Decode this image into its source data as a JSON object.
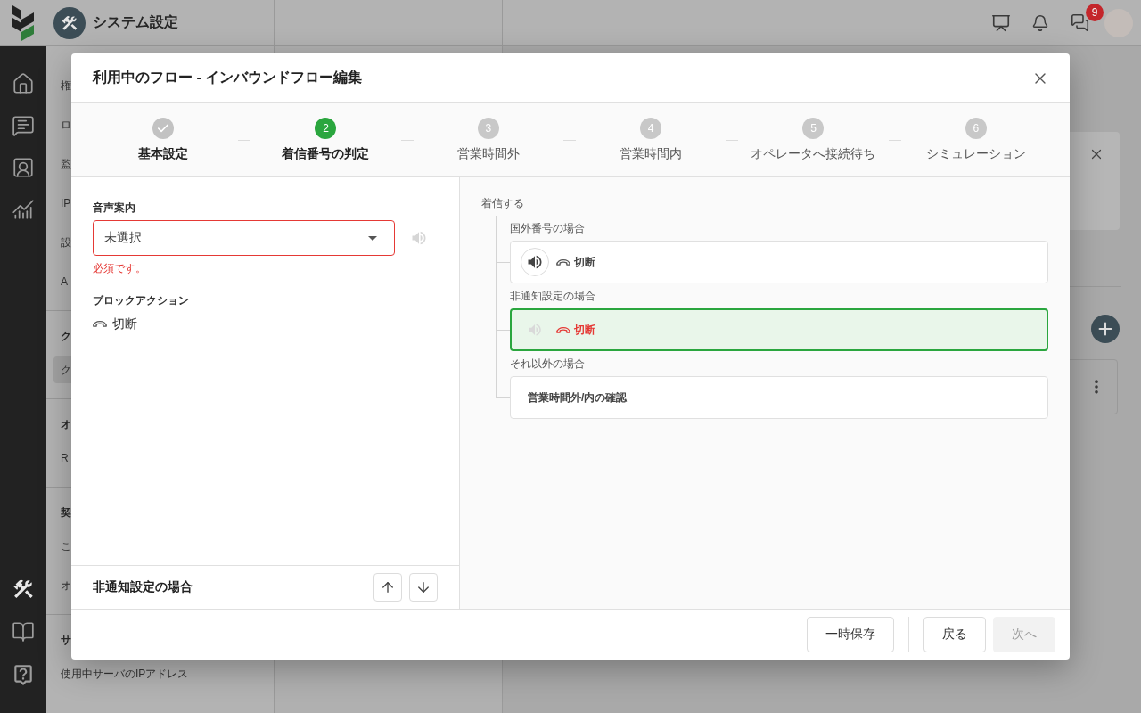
{
  "rail": {
    "top": [
      {
        "selected": false
      },
      {
        "selected": false
      },
      {
        "selected": false
      },
      {
        "selected": false
      }
    ],
    "bottom": [
      {
        "selected": true
      },
      {
        "selected": false
      },
      {
        "selected": false
      }
    ]
  },
  "header": {
    "title": "システム設定",
    "chat_badge": "9"
  },
  "sidebar": {
    "sections": [
      {
        "items": [
          {
            "label": "権",
            "selected": false
          },
          {
            "label": "ロ",
            "selected": false
          },
          {
            "label": "監",
            "selected": false
          },
          {
            "label": "IP",
            "selected": false
          },
          {
            "label": "設",
            "selected": false
          },
          {
            "label": "A",
            "selected": false
          }
        ]
      },
      {
        "title": "ク",
        "items": [
          {
            "label": "ク",
            "selected": true
          }
        ]
      },
      {
        "title": "オ",
        "items": [
          {
            "label": "R",
            "selected": false
          }
        ]
      },
      {
        "title": "契",
        "items": [
          {
            "label": "こ",
            "selected": false
          },
          {
            "label": "オ",
            "selected": false
          }
        ]
      },
      {
        "title": "サ",
        "items": [
          {
            "label": "使用中サーバのIPアドレス",
            "selected": false
          }
        ]
      }
    ]
  },
  "modal": {
    "title": "利用中のフロー - インバウンドフロー編集",
    "steps": [
      {
        "label": "基本設定",
        "completed": true,
        "selected": false
      },
      {
        "number": "2",
        "label": "着信番号の判定",
        "completed": false,
        "selected": true
      },
      {
        "number": "3",
        "label": "営業時間外",
        "completed": false,
        "selected": false
      },
      {
        "number": "4",
        "label": "営業時間内",
        "completed": false,
        "selected": false
      },
      {
        "number": "5",
        "label": "オペレータへ接続待ち",
        "completed": false,
        "selected": false
      },
      {
        "number": "6",
        "label": "シミュレーション",
        "completed": false,
        "selected": false
      }
    ],
    "form": {
      "voice_guide": {
        "label": "音声案内",
        "value": "未選択",
        "invalid": true,
        "error": "必須です。",
        "preview_disabled": true
      },
      "block_action": {
        "label": "ブロックアクション",
        "value": "切断"
      }
    },
    "selection_bar": {
      "label": "非通知設定の場合"
    },
    "flow": {
      "root": "着信する",
      "branches": [
        {
          "label": "国外番号の場合",
          "kind": "action",
          "selected": false,
          "audio_set": true,
          "error": false,
          "text": "切断"
        },
        {
          "label": "非通知設定の場合",
          "kind": "action",
          "selected": true,
          "audio_set": false,
          "error": true,
          "text": "切断"
        },
        {
          "label": "それ以外の場合",
          "kind": "link",
          "selected": false,
          "text": "営業時間外/内の確認"
        }
      ]
    },
    "buttons": [
      {
        "label": "一時保存",
        "disabled": false
      },
      {
        "label": "戻る",
        "disabled": false
      },
      {
        "label": "次へ",
        "disabled": true
      }
    ]
  }
}
